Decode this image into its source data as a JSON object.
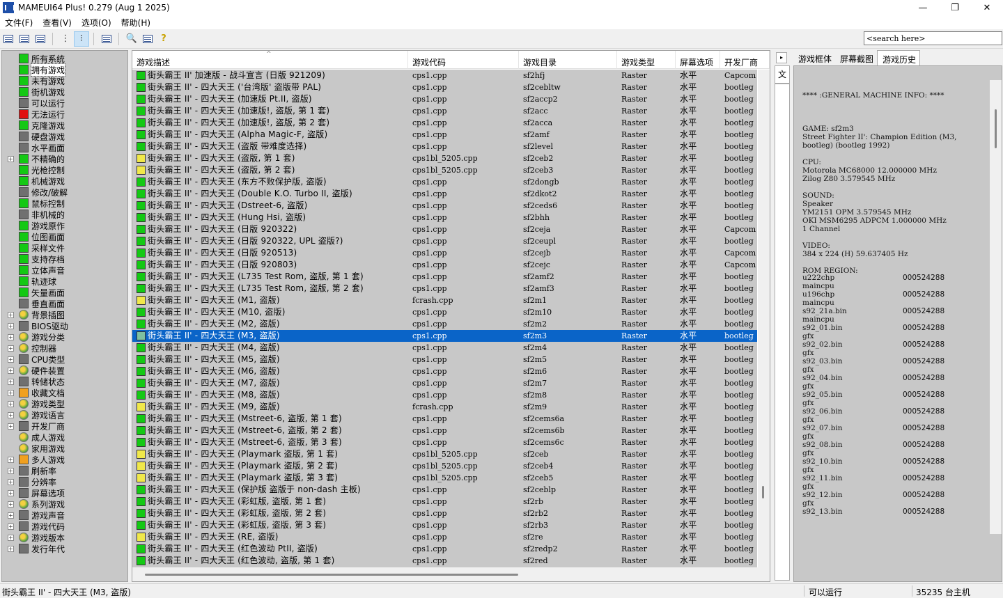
{
  "window": {
    "title": "MAMEUI64 Plus! 0.279 (Aug  1 2025)",
    "min_glyph": "—",
    "max_glyph": "❐",
    "close_glyph": "✕"
  },
  "menu": [
    "文件(F)",
    "查看(V)",
    "选项(O)",
    "帮助(H)"
  ],
  "toolbar": {
    "search_value": "<search here>",
    "find_glyph": "🔍",
    "help_glyph": "?"
  },
  "tree": [
    {
      "label": "所有系统",
      "icon": "green",
      "exp": false
    },
    {
      "label": "拥有游戏",
      "icon": "green",
      "exp": false,
      "selected": true
    },
    {
      "label": "未有游戏",
      "icon": "green",
      "exp": false
    },
    {
      "label": "街机游戏",
      "icon": "green",
      "exp": false
    },
    {
      "label": "可以运行",
      "icon": "gray",
      "exp": false
    },
    {
      "label": "无法运行",
      "icon": "red",
      "exp": false
    },
    {
      "label": "克隆游戏",
      "icon": "green",
      "exp": false
    },
    {
      "label": "硬盘游戏",
      "icon": "gray",
      "exp": false
    },
    {
      "label": "水平画面",
      "icon": "gray",
      "exp": false
    },
    {
      "label": "不精确的",
      "icon": "green",
      "exp": true
    },
    {
      "label": "光枪控制",
      "icon": "green",
      "exp": false
    },
    {
      "label": "机械游戏",
      "icon": "green",
      "exp": false
    },
    {
      "label": "修改/破解",
      "icon": "gray",
      "exp": false
    },
    {
      "label": "鼠标控制",
      "icon": "green",
      "exp": false
    },
    {
      "label": "非机械的",
      "icon": "gray",
      "exp": false
    },
    {
      "label": "游戏原作",
      "icon": "green",
      "exp": false
    },
    {
      "label": "位图画面",
      "icon": "green",
      "exp": false
    },
    {
      "label": "采样文件",
      "icon": "green",
      "exp": false
    },
    {
      "label": "支持存档",
      "icon": "green",
      "exp": false
    },
    {
      "label": "立体声音",
      "icon": "green",
      "exp": false
    },
    {
      "label": "轨迹球",
      "icon": "green",
      "exp": false
    },
    {
      "label": "矢量画面",
      "icon": "green",
      "exp": false
    },
    {
      "label": "垂直画面",
      "icon": "gray",
      "exp": false
    },
    {
      "label": "背景插图",
      "icon": "round",
      "exp": true
    },
    {
      "label": "BIOS驱动",
      "icon": "gray",
      "exp": true
    },
    {
      "label": "游戏分类",
      "icon": "round",
      "exp": true
    },
    {
      "label": "控制器",
      "icon": "round",
      "exp": true
    },
    {
      "label": "CPU类型",
      "icon": "gray",
      "exp": true
    },
    {
      "label": "硬件装置",
      "icon": "round",
      "exp": true
    },
    {
      "label": "转储状态",
      "icon": "gray",
      "exp": true
    },
    {
      "label": "收藏文档",
      "icon": "orange",
      "exp": true
    },
    {
      "label": "游戏类型",
      "icon": "round",
      "exp": true
    },
    {
      "label": "游戏语言",
      "icon": "round",
      "exp": true
    },
    {
      "label": "开发厂商",
      "icon": "gray",
      "exp": true
    },
    {
      "label": "成人游戏",
      "icon": "round",
      "exp": false
    },
    {
      "label": "家用游戏",
      "icon": "round",
      "exp": false
    },
    {
      "label": "多人游戏",
      "icon": "orange",
      "exp": true
    },
    {
      "label": "刷新率",
      "icon": "gray",
      "exp": true
    },
    {
      "label": "分辨率",
      "icon": "gray",
      "exp": true
    },
    {
      "label": "屏幕选项",
      "icon": "gray",
      "exp": true
    },
    {
      "label": "系列游戏",
      "icon": "round",
      "exp": true
    },
    {
      "label": "游戏声音",
      "icon": "gray",
      "exp": true
    },
    {
      "label": "游戏代码",
      "icon": "gray",
      "exp": true
    },
    {
      "label": "游戏版本",
      "icon": "round",
      "exp": true
    },
    {
      "label": "发行年代",
      "icon": "gray",
      "exp": true
    }
  ],
  "list": {
    "columns": [
      "游戏描述",
      "游戏代码",
      "游戏目录",
      "游戏类型",
      "屏幕选项",
      "开发厂商"
    ],
    "rows": [
      {
        "desc": "街头霸王 II' 加速版 - 战斗宣言 (日版 921209)",
        "code": "cps1.cpp",
        "dir": "sf2hfj",
        "type": "Raster",
        "screen": "水平",
        "maker": "Capcom",
        "icon": "g"
      },
      {
        "desc": "街头霸王 II' - 四大天王 ('台湾版' 盗版带 PAL)",
        "code": "cps1.cpp",
        "dir": "sf2cebltw",
        "type": "Raster",
        "screen": "水平",
        "maker": "bootleg",
        "icon": "g"
      },
      {
        "desc": "街头霸王 II' - 四大天王 (加速版 Pt.II, 盗版)",
        "code": "cps1.cpp",
        "dir": "sf2accp2",
        "type": "Raster",
        "screen": "水平",
        "maker": "bootleg",
        "icon": "g"
      },
      {
        "desc": "街头霸王 II' - 四大天王 (加速版!, 盗版, 第 1 套)",
        "code": "cps1.cpp",
        "dir": "sf2acc",
        "type": "Raster",
        "screen": "水平",
        "maker": "bootleg",
        "icon": "g"
      },
      {
        "desc": "街头霸王 II' - 四大天王 (加速版!, 盗版, 第 2 套)",
        "code": "cps1.cpp",
        "dir": "sf2acca",
        "type": "Raster",
        "screen": "水平",
        "maker": "bootleg",
        "icon": "g"
      },
      {
        "desc": "街头霸王 II' - 四大天王 (Alpha Magic-F, 盗版)",
        "code": "cps1.cpp",
        "dir": "sf2amf",
        "type": "Raster",
        "screen": "水平",
        "maker": "bootleg",
        "icon": "g"
      },
      {
        "desc": "街头霸王 II' - 四大天王 (盗版 带难度选择)",
        "code": "cps1.cpp",
        "dir": "sf2level",
        "type": "Raster",
        "screen": "水平",
        "maker": "bootleg",
        "icon": "g"
      },
      {
        "desc": "街头霸王 II' - 四大天王 (盗版, 第 1 套)",
        "code": "cps1bl_5205.cpp",
        "dir": "sf2ceb2",
        "type": "Raster",
        "screen": "水平",
        "maker": "bootleg",
        "icon": "y"
      },
      {
        "desc": "街头霸王 II' - 四大天王 (盗版, 第 2 套)",
        "code": "cps1bl_5205.cpp",
        "dir": "sf2ceb3",
        "type": "Raster",
        "screen": "水平",
        "maker": "bootleg",
        "icon": "y"
      },
      {
        "desc": "街头霸王 II' - 四大天王 (东方不败保护版, 盗版)",
        "code": "cps1.cpp",
        "dir": "sf2dongb",
        "type": "Raster",
        "screen": "水平",
        "maker": "bootleg",
        "icon": "g"
      },
      {
        "desc": "街头霸王 II' - 四大天王 (Double K.O. Turbo II, 盗版)",
        "code": "cps1.cpp",
        "dir": "sf2dkot2",
        "type": "Raster",
        "screen": "水平",
        "maker": "bootleg",
        "icon": "g"
      },
      {
        "desc": "街头霸王 II' - 四大天王 (Dstreet-6, 盗版)",
        "code": "cps1.cpp",
        "dir": "sf2ceds6",
        "type": "Raster",
        "screen": "水平",
        "maker": "bootleg",
        "icon": "g"
      },
      {
        "desc": "街头霸王 II' - 四大天王 (Hung Hsi, 盗版)",
        "code": "cps1.cpp",
        "dir": "sf2bhh",
        "type": "Raster",
        "screen": "水平",
        "maker": "bootleg",
        "icon": "g"
      },
      {
        "desc": "街头霸王 II' - 四大天王 (日版 920322)",
        "code": "cps1.cpp",
        "dir": "sf2ceja",
        "type": "Raster",
        "screen": "水平",
        "maker": "Capcom",
        "icon": "g"
      },
      {
        "desc": "街头霸王 II' - 四大天王 (日版 920322, UPL 盗版?)",
        "code": "cps1.cpp",
        "dir": "sf2ceupl",
        "type": "Raster",
        "screen": "水平",
        "maker": "bootleg",
        "icon": "g"
      },
      {
        "desc": "街头霸王 II' - 四大天王 (日版 920513)",
        "code": "cps1.cpp",
        "dir": "sf2cejb",
        "type": "Raster",
        "screen": "水平",
        "maker": "Capcom",
        "icon": "g"
      },
      {
        "desc": "街头霸王 II' - 四大天王 (日版 920803)",
        "code": "cps1.cpp",
        "dir": "sf2cejc",
        "type": "Raster",
        "screen": "水平",
        "maker": "Capcom",
        "icon": "g"
      },
      {
        "desc": "街头霸王 II' - 四大天王 (L735 Test Rom, 盗版, 第 1 套)",
        "code": "cps1.cpp",
        "dir": "sf2amf2",
        "type": "Raster",
        "screen": "水平",
        "maker": "bootleg",
        "icon": "g"
      },
      {
        "desc": "街头霸王 II' - 四大天王 (L735 Test Rom, 盗版, 第 2 套)",
        "code": "cps1.cpp",
        "dir": "sf2amf3",
        "type": "Raster",
        "screen": "水平",
        "maker": "bootleg",
        "icon": "g"
      },
      {
        "desc": "街头霸王 II' - 四大天王 (M1, 盗版)",
        "code": "fcrash.cpp",
        "dir": "sf2m1",
        "type": "Raster",
        "screen": "水平",
        "maker": "bootleg",
        "icon": "y"
      },
      {
        "desc": "街头霸王 II' - 四大天王 (M10, 盗版)",
        "code": "cps1.cpp",
        "dir": "sf2m10",
        "type": "Raster",
        "screen": "水平",
        "maker": "bootleg",
        "icon": "g"
      },
      {
        "desc": "街头霸王 II' - 四大天王 (M2, 盗版)",
        "code": "cps1.cpp",
        "dir": "sf2m2",
        "type": "Raster",
        "screen": "水平",
        "maker": "bootleg",
        "icon": "g"
      },
      {
        "desc": "街头霸王 II' - 四大天王 (M3, 盗版)",
        "code": "cps1.cpp",
        "dir": "sf2m3",
        "type": "Raster",
        "screen": "水平",
        "maker": "bootleg",
        "icon": "g",
        "selected": true
      },
      {
        "desc": "街头霸王 II' - 四大天王 (M4, 盗版)",
        "code": "cps1.cpp",
        "dir": "sf2m4",
        "type": "Raster",
        "screen": "水平",
        "maker": "bootleg",
        "icon": "g"
      },
      {
        "desc": "街头霸王 II' - 四大天王 (M5, 盗版)",
        "code": "cps1.cpp",
        "dir": "sf2m5",
        "type": "Raster",
        "screen": "水平",
        "maker": "bootleg",
        "icon": "g"
      },
      {
        "desc": "街头霸王 II' - 四大天王 (M6, 盗版)",
        "code": "cps1.cpp",
        "dir": "sf2m6",
        "type": "Raster",
        "screen": "水平",
        "maker": "bootleg",
        "icon": "g"
      },
      {
        "desc": "街头霸王 II' - 四大天王 (M7, 盗版)",
        "code": "cps1.cpp",
        "dir": "sf2m7",
        "type": "Raster",
        "screen": "水平",
        "maker": "bootleg",
        "icon": "g"
      },
      {
        "desc": "街头霸王 II' - 四大天王 (M8, 盗版)",
        "code": "cps1.cpp",
        "dir": "sf2m8",
        "type": "Raster",
        "screen": "水平",
        "maker": "bootleg",
        "icon": "g"
      },
      {
        "desc": "街头霸王 II' - 四大天王 (M9, 盗版)",
        "code": "fcrash.cpp",
        "dir": "sf2m9",
        "type": "Raster",
        "screen": "水平",
        "maker": "bootleg",
        "icon": "y"
      },
      {
        "desc": "街头霸王 II' - 四大天王 (Mstreet-6, 盗版, 第 1 套)",
        "code": "cps1.cpp",
        "dir": "sf2cems6a",
        "type": "Raster",
        "screen": "水平",
        "maker": "bootleg",
        "icon": "g"
      },
      {
        "desc": "街头霸王 II' - 四大天王 (Mstreet-6, 盗版, 第 2 套)",
        "code": "cps1.cpp",
        "dir": "sf2cems6b",
        "type": "Raster",
        "screen": "水平",
        "maker": "bootleg",
        "icon": "g"
      },
      {
        "desc": "街头霸王 II' - 四大天王 (Mstreet-6, 盗版, 第 3 套)",
        "code": "cps1.cpp",
        "dir": "sf2cems6c",
        "type": "Raster",
        "screen": "水平",
        "maker": "bootleg",
        "icon": "g"
      },
      {
        "desc": "街头霸王 II' - 四大天王 (Playmark 盗版, 第 1 套)",
        "code": "cps1bl_5205.cpp",
        "dir": "sf2ceb",
        "type": "Raster",
        "screen": "水平",
        "maker": "bootleg",
        "icon": "y"
      },
      {
        "desc": "街头霸王 II' - 四大天王 (Playmark 盗版, 第 2 套)",
        "code": "cps1bl_5205.cpp",
        "dir": "sf2ceb4",
        "type": "Raster",
        "screen": "水平",
        "maker": "bootleg",
        "icon": "y"
      },
      {
        "desc": "街头霸王 II' - 四大天王 (Playmark 盗版, 第 3 套)",
        "code": "cps1bl_5205.cpp",
        "dir": "sf2ceb5",
        "type": "Raster",
        "screen": "水平",
        "maker": "bootleg",
        "icon": "y"
      },
      {
        "desc": "街头霸王 II' - 四大天王 (保护版 盗版于 non-dash 主板)",
        "code": "cps1.cpp",
        "dir": "sf2ceblp",
        "type": "Raster",
        "screen": "水平",
        "maker": "bootleg",
        "icon": "g"
      },
      {
        "desc": "街头霸王 II' - 四大天王 (彩虹版, 盗版, 第 1 套)",
        "code": "cps1.cpp",
        "dir": "sf2rb",
        "type": "Raster",
        "screen": "水平",
        "maker": "bootleg",
        "icon": "g"
      },
      {
        "desc": "街头霸王 II' - 四大天王 (彩虹版, 盗版, 第 2 套)",
        "code": "cps1.cpp",
        "dir": "sf2rb2",
        "type": "Raster",
        "screen": "水平",
        "maker": "bootleg",
        "icon": "g"
      },
      {
        "desc": "街头霸王 II' - 四大天王 (彩虹版, 盗版, 第 3 套)",
        "code": "cps1.cpp",
        "dir": "sf2rb3",
        "type": "Raster",
        "screen": "水平",
        "maker": "bootleg",
        "icon": "g"
      },
      {
        "desc": "街头霸王 II' - 四大天王 (RE, 盗版)",
        "code": "cps1.cpp",
        "dir": "sf2re",
        "type": "Raster",
        "screen": "水平",
        "maker": "bootleg",
        "icon": "y"
      },
      {
        "desc": "街头霸王 II' - 四大天王 (红色波动 PtII, 盗版)",
        "code": "cps1.cpp",
        "dir": "sf2redp2",
        "type": "Raster",
        "screen": "水平",
        "maker": "bootleg",
        "icon": "g"
      },
      {
        "desc": "街头霸王 II' - 四大天王 (红色波动, 盗版, 第 1 套)",
        "code": "cps1.cpp",
        "dir": "sf2red",
        "type": "Raster",
        "screen": "水平",
        "maker": "bootleg",
        "icon": "g"
      }
    ]
  },
  "mid": {
    "arrow": "▸",
    "tab": "文"
  },
  "right": {
    "tabs": [
      "游戏框体",
      "屏幕截图",
      "游戏历史"
    ],
    "info": [
      "**** :GENERAL MACHINE INFO: ****",
      "",
      "",
      "",
      "GAME: sf2m3",
      "Street Fighter II': Champion Edition (M3,",
      "bootleg) (bootleg 1992)",
      "",
      "CPU:",
      "Motorola MC68000 12.000000 MHz",
      "Zilog Z80 3.579545 MHz",
      "",
      "SOUND:",
      "Speaker",
      "YM2151 OPM 3.579545 MHz",
      "OKI MSM6295 ADPCM 1.000000 MHz",
      "1 Channel",
      "",
      "VIDEO:",
      "384 x 224 (H) 59.637405 Hz",
      "",
      "ROM REGION:"
    ],
    "roms": [
      {
        "name": "u222chp",
        "size": "000524288",
        "region": "maincpu"
      },
      {
        "name": "u196chp",
        "size": "000524288",
        "region": "maincpu"
      },
      {
        "name": "s92_21a.bin",
        "size": "000524288",
        "region": "maincpu"
      },
      {
        "name": "s92_01.bin",
        "size": "000524288",
        "region": "gfx"
      },
      {
        "name": "s92_02.bin",
        "size": "000524288",
        "region": "gfx"
      },
      {
        "name": "s92_03.bin",
        "size": "000524288",
        "region": "gfx"
      },
      {
        "name": "s92_04.bin",
        "size": "000524288",
        "region": "gfx"
      },
      {
        "name": "s92_05.bin",
        "size": "000524288",
        "region": "gfx"
      },
      {
        "name": "s92_06.bin",
        "size": "000524288",
        "region": "gfx"
      },
      {
        "name": "s92_07.bin",
        "size": "000524288",
        "region": "gfx"
      },
      {
        "name": "s92_08.bin",
        "size": "000524288",
        "region": "gfx"
      },
      {
        "name": "s92_10.bin",
        "size": "000524288",
        "region": "gfx"
      },
      {
        "name": "s92_11.bin",
        "size": "000524288",
        "region": "gfx"
      },
      {
        "name": "s92_12.bin",
        "size": "000524288",
        "region": "gfx"
      },
      {
        "name": "s92_13.bin",
        "size": "000524288",
        "region": ""
      }
    ]
  },
  "status": {
    "game": "街头霸王 II' - 四大天王 (M3, 盗版)",
    "state": "可以运行",
    "count": "35235 台主机"
  },
  "colors": {
    "green": "#14c814",
    "yellow": "#f0e84a",
    "red": "#e01010",
    "gray": "#707070",
    "orange": "#f0a020",
    "selection": "#0a64c8"
  }
}
